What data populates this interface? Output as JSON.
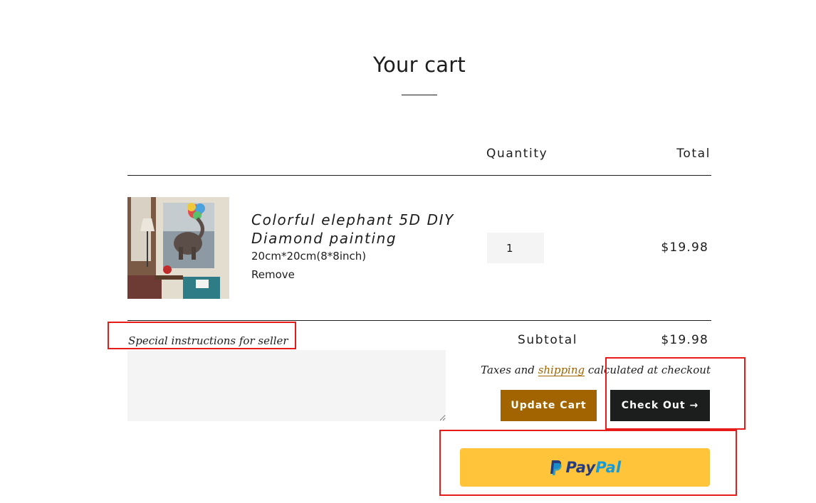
{
  "page": {
    "title": "Your cart"
  },
  "table": {
    "headers": {
      "quantity": "Quantity",
      "total": "Total"
    }
  },
  "item": {
    "title": "Colorful elephant 5D DIY Diamond painting",
    "variant": "20cm*20cm(8*8inch)",
    "remove_label": "Remove",
    "quantity": "1",
    "line_total": "$19.98"
  },
  "instructions": {
    "label": "Special instructions for seller",
    "value": ""
  },
  "summary": {
    "subtotal_label": "Subtotal",
    "subtotal_value": "$19.98",
    "tax_prefix": "Taxes and",
    "tax_link": "shipping",
    "tax_suffix": "calculated at checkout"
  },
  "buttons": {
    "update_cart": "Update Cart",
    "check_out": "Check Out →",
    "paypal_pay": "Pay",
    "paypal_pal": "Pal"
  },
  "colors": {
    "accent": "#a16400",
    "dark": "#1c1d1d",
    "paypal_yellow": "#ffc439",
    "highlight": "#e81b1b"
  }
}
